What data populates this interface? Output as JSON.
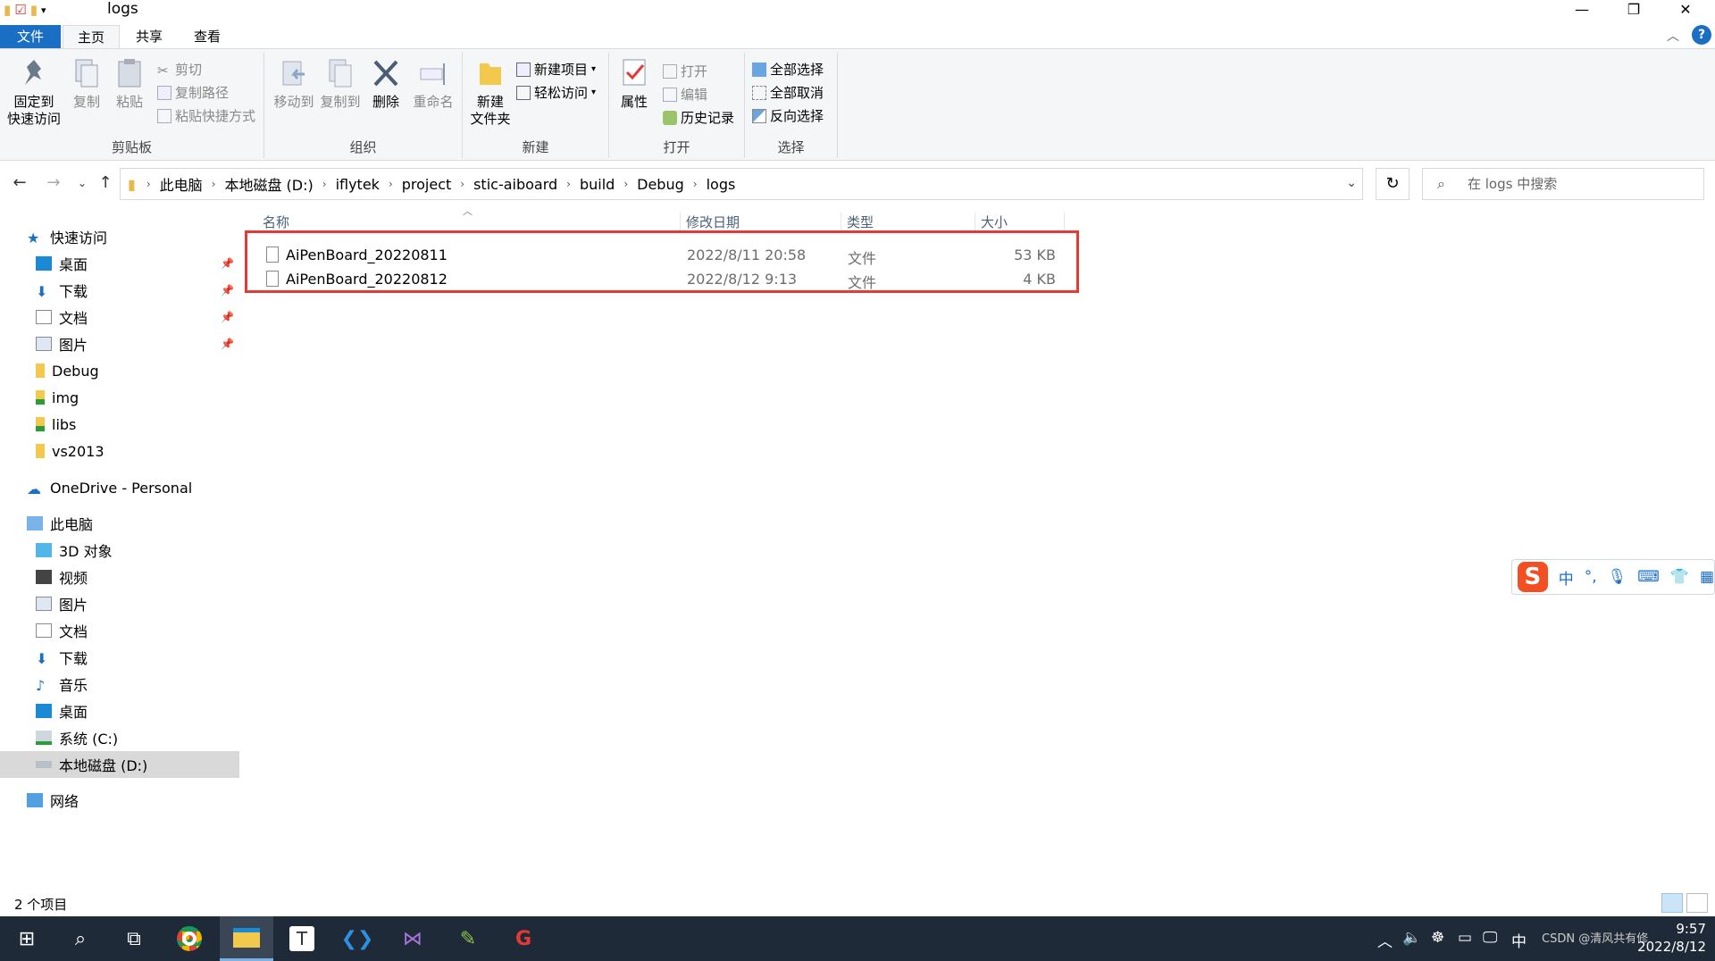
{
  "window": {
    "title": "logs"
  },
  "tabs": {
    "file": "文件",
    "home": "主页",
    "share": "共享",
    "view": "查看"
  },
  "ribbon": {
    "clipboard": {
      "label": "剪贴板",
      "pin": "固定到\n快速访问",
      "pin_l1": "固定到",
      "pin_l2": "快速访问",
      "copy": "复制",
      "paste": "粘贴",
      "cut": "剪切",
      "copy_path": "复制路径",
      "paste_shortcut": "粘贴快捷方式"
    },
    "organize": {
      "label": "组织",
      "move_to": "移动到",
      "copy_to": "复制到",
      "delete": "删除",
      "rename": "重命名"
    },
    "new": {
      "label": "新建",
      "new_folder_l1": "新建",
      "new_folder_l2": "文件夹",
      "new_item": "新建项目",
      "easy_access": "轻松访问"
    },
    "open": {
      "label": "打开",
      "properties": "属性",
      "open": "打开",
      "edit": "编辑",
      "history": "历史记录"
    },
    "select": {
      "label": "选择",
      "select_all": "全部选择",
      "select_none": "全部取消",
      "invert": "反向选择"
    }
  },
  "address": {
    "crumbs": [
      "此电脑",
      "本地磁盘 (D:)",
      "iflytek",
      "project",
      "stic-aiboard",
      "build",
      "Debug",
      "logs"
    ],
    "search_placeholder": "在 logs 中搜索"
  },
  "navpane": {
    "quick_access": "快速访问",
    "quick_items": [
      "桌面",
      "下载",
      "文档",
      "图片",
      "Debug",
      "img",
      "libs",
      "vs2013"
    ],
    "onedrive": "OneDrive - Personal",
    "this_pc": "此电脑",
    "pc_items": [
      "3D 对象",
      "视频",
      "图片",
      "文档",
      "下载",
      "音乐",
      "桌面",
      "系统 (C:)",
      "本地磁盘 (D:)"
    ],
    "network": "网络"
  },
  "columns": {
    "name": "名称",
    "modified": "修改日期",
    "type": "类型",
    "size": "大小"
  },
  "files": [
    {
      "name": "AiPenBoard_20220811",
      "modified": "2022/8/11 20:58",
      "type": "文件",
      "size": "53 KB"
    },
    {
      "name": "AiPenBoard_20220812",
      "modified": "2022/8/12 9:13",
      "type": "文件",
      "size": "4 KB"
    }
  ],
  "status": {
    "count": "2 个项目"
  },
  "ime": {
    "mode": "中"
  },
  "taskbar": {
    "time": "9:57",
    "date": "2022/8/12",
    "lang": "中",
    "watermark": "CSDN @清风共有修"
  },
  "colors": {
    "accent": "#1a6fc4",
    "highlight": "#e53935",
    "taskbar": "#1f2a38"
  }
}
